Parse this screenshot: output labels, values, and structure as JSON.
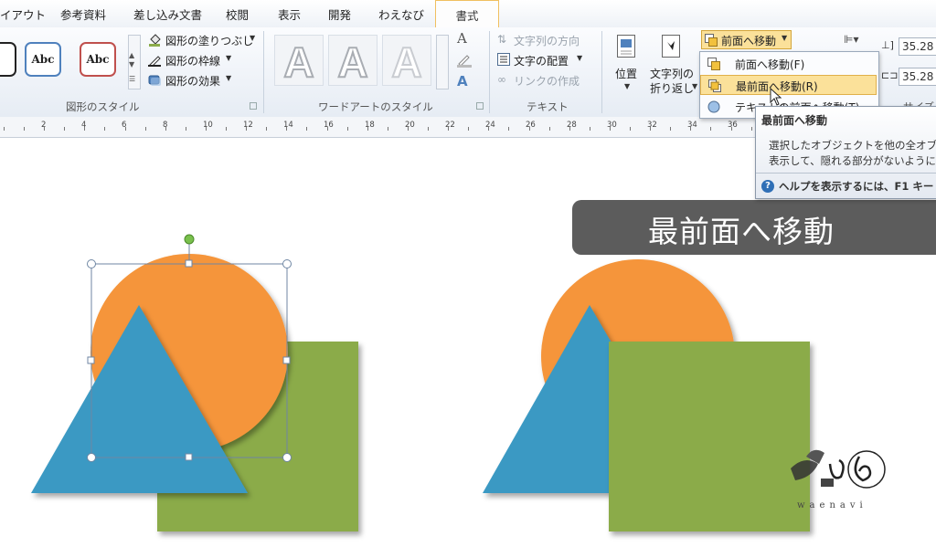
{
  "tabs": [
    {
      "label": "イアウト",
      "active": false
    },
    {
      "label": "参考資料",
      "active": false
    },
    {
      "label": "差し込み文書",
      "active": false
    },
    {
      "label": "校閲",
      "active": false
    },
    {
      "label": "表示",
      "active": false
    },
    {
      "label": "開発",
      "active": false
    },
    {
      "label": "わえなび",
      "active": false
    },
    {
      "label": "書式",
      "active": true
    }
  ],
  "ribbon": {
    "shape_styles": {
      "samples": [
        "Abc",
        "Abc"
      ],
      "fill": "図形の塗りつぶし",
      "outline": "図形の枠線",
      "effects": "図形の効果",
      "group_label": "図形のスタイル"
    },
    "wordart": {
      "sample": "A",
      "group_label": "ワードアートのスタイル",
      "text_fill_icon": "A"
    },
    "text": {
      "direction": "文字列の方向",
      "align": "文字の配置",
      "link": "リンクの作成",
      "group_label": "テキスト"
    },
    "arrange": {
      "position_label": "位置",
      "wrap_label_1": "文字列の",
      "wrap_label_2": "折り返し",
      "bring_forward": "前面へ移動",
      "group_tail": "サイズ"
    },
    "size": {
      "height": "35.28",
      "width": "35.28"
    }
  },
  "dropdown": {
    "items": [
      {
        "label": "前面へ移動(F)",
        "highlighted": false
      },
      {
        "label": "最前面へ移動(R)",
        "highlighted": true
      },
      {
        "label": "テキストの前面へ移動(T)",
        "highlighted": false
      }
    ]
  },
  "tooltip": {
    "title": "最前面へ移動",
    "line1": "選択したオブジェクトを他の全オブジェ",
    "line2": "表示して、隠れる部分がないようにし",
    "help": "ヘルプを表示するには、F1 キー"
  },
  "ruler": {
    "numbers": [
      "2",
      "4",
      "6",
      "8",
      "10",
      "12",
      "14",
      "16",
      "18",
      "20",
      "22",
      "24",
      "26",
      "28",
      "30",
      "32",
      "34",
      "36"
    ]
  },
  "caption": "最前面へ移動",
  "watermark": "waenavi",
  "colors": {
    "circle": "#f5953a",
    "triangle": "#3a99c3",
    "square": "#8bab4a",
    "caption_bg": "#545454",
    "active_tab_border": "#f0c060",
    "highlight": "#fbe19a"
  }
}
